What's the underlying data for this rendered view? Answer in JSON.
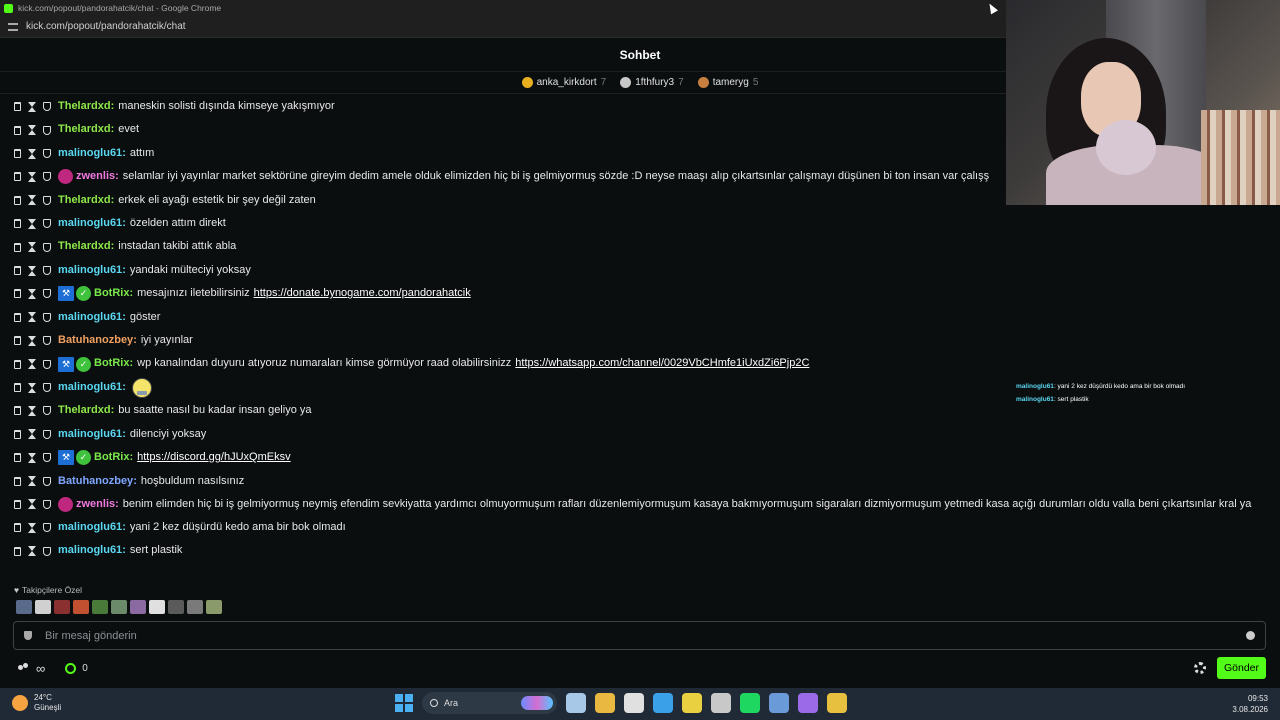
{
  "window": {
    "title": "kick.com/popout/pandorahatcik/chat - Google Chrome",
    "url": "kick.com/popout/pandorahatcik/chat"
  },
  "chat": {
    "header": "Sohbet",
    "leaderboard": [
      {
        "name": "anka_kirkdort",
        "count": "7",
        "color": "#e8b020"
      },
      {
        "name": "1fthfury3",
        "count": "7",
        "color": "#c8c8c8"
      },
      {
        "name": "tameryg",
        "count": "5",
        "color": "#c88040"
      }
    ],
    "messages": [
      {
        "user": "Thelardxd",
        "color": "green",
        "badges": [],
        "text": "maneskin solisti dışında kimseye yakışmıyor"
      },
      {
        "user": "Thelardxd",
        "color": "green",
        "badges": [],
        "text": "evet"
      },
      {
        "user": "malinoglu61",
        "color": "cyan",
        "badges": [],
        "text": "attım"
      },
      {
        "user": "zwenlis",
        "color": "pink",
        "badges": [
          "sub"
        ],
        "text": "selamlar iyi yayınlar market sektörüne gireyim dedim amele olduk elimizden hiç bi iş gelmiyormuş sözde :D neyse maaşı alıp çıkartsınlar çalışmayı düşünen bi ton insan var çalışş"
      },
      {
        "user": "Thelardxd",
        "color": "green",
        "badges": [],
        "text": "erkek eli ayağı estetik bir şey değil zaten"
      },
      {
        "user": "malinoglu61",
        "color": "cyan",
        "badges": [],
        "text": "özelden attım direkt"
      },
      {
        "user": "Thelardxd",
        "color": "green",
        "badges": [],
        "text": "instadan takibi attık abla"
      },
      {
        "user": "malinoglu61",
        "color": "cyan",
        "badges": [],
        "text": "yandaki mülteciyi yoksay"
      },
      {
        "user": "BotRix",
        "color": "botgreen",
        "badges": [
          "bot",
          "verified"
        ],
        "text": "mesajınızı iletebilirsiniz",
        "link": "https://donate.bynogame.com/pandorahatcik"
      },
      {
        "user": "malinoglu61",
        "color": "cyan",
        "badges": [],
        "text": "göster"
      },
      {
        "user": "Batuhanozbey",
        "color": "orange",
        "badges": [],
        "text": "iyi yayınlar"
      },
      {
        "user": "BotRix",
        "color": "botgreen",
        "badges": [
          "bot",
          "verified"
        ],
        "text": "wp kanalından duyuru atıyoruz numaraları kimse görmüyor raad olabilirsinizz",
        "link": "https://whatsapp.com/channel/0029VbCHmfe1iUxdZi6Pjp2C"
      },
      {
        "user": "malinoglu61",
        "color": "cyan",
        "badges": [],
        "text": "",
        "emote": "emote-icon"
      },
      {
        "user": "Thelardxd",
        "color": "green",
        "badges": [],
        "text": "bu saatte nasıl bu kadar insan geliyo ya"
      },
      {
        "user": "malinoglu61",
        "color": "cyan",
        "badges": [],
        "text": "dilenciyi yoksay"
      },
      {
        "user": "BotRix",
        "color": "botgreen",
        "badges": [
          "bot",
          "verified"
        ],
        "text": "",
        "link": "https://discord.gg/hJUxQmEksv"
      },
      {
        "user": "Batuhanozbey",
        "color": "blue",
        "badges": [],
        "text": "hoşbuldum nasılsınız"
      },
      {
        "user": "zwenlis",
        "color": "pink",
        "badges": [
          "sub"
        ],
        "text": "benim elimden hiç bi iş gelmiyormuş neymiş efendim sevkiyatta yardımcı olmuyormuşum rafları düzenlemiyormuşum kasaya bakmıyormuşum sigaraları dizmiyormuşum yetmedi kasa açığı durumları oldu valla beni çıkartsınlar kral ya",
        "wrap": true
      },
      {
        "user": "malinoglu61",
        "color": "cyan",
        "badges": [],
        "text": "yani 2 kez düşürdü kedo ama bir bok olmadı"
      },
      {
        "user": "malinoglu61",
        "color": "cyan",
        "badges": [],
        "text": "sert plastik"
      }
    ],
    "followers_label": "Takipçilere Özel",
    "emote_colors": [
      "#5a6a8a",
      "#d0d0d0",
      "#8a3030",
      "#c05030",
      "#4a7a3a",
      "#6a8a6a",
      "#8a6aa0",
      "#e0e0e0",
      "#5a5a5a",
      "#7a7a7a",
      "#8a9a6a"
    ],
    "input_placeholder": "Bir mesaj gönderin",
    "points": "0",
    "send_label": "Gönder",
    "infinity": "∞"
  },
  "overlay": [
    {
      "user": "malinoglu61",
      "text": ": yani 2 kez düşürdü kedo ama bir bok olmadı"
    },
    {
      "user": "malinoglu61",
      "text": ": sert plastik"
    }
  ],
  "taskbar": {
    "temp": "24°C",
    "weather": "Güneşli",
    "search": "Ara",
    "time": "09:53",
    "date": "3.08.2026",
    "icon_colors": [
      "#a8c8e8",
      "#e8b840",
      "#e0e0e0",
      "#3aa0e8",
      "#e8d040",
      "#c8c8c8",
      "#1ed760",
      "#6a9ad8",
      "#9a6ae8",
      "#e8c040"
    ]
  }
}
